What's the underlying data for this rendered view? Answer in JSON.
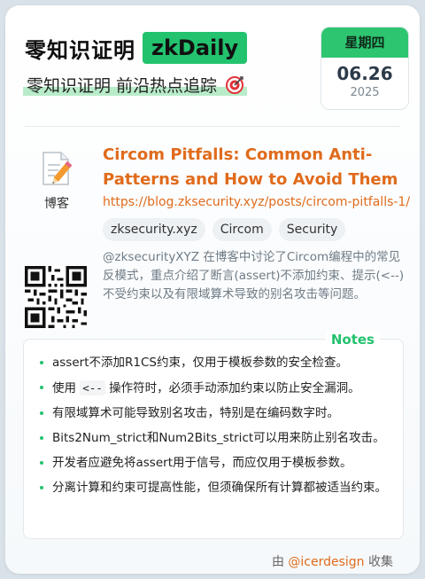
{
  "header": {
    "title": "零知识证明",
    "brand": "zkDaily",
    "subtitle": "零知识证明 前沿热点追踪",
    "subtitle_icon": "target-icon"
  },
  "date": {
    "weekday": "星期四",
    "day": "06.26",
    "year": "2025"
  },
  "post": {
    "category": "博客",
    "category_icon": "memo-icon",
    "title": "Circom Pitfalls: Common Anti-Patterns and How to Avoid Them",
    "url": "https://blog.zksecurity.xyz/posts/circom-pitfalls-1/",
    "tags": [
      "zksecurity.xyz",
      "Circom",
      "Security"
    ],
    "description": "@zksecurityXYZ 在博客中讨论了Circom编程中的常见反模式，重点介绍了断言(assert)不添加约束、提示(<--)不受约束以及有限域算术导致的别名攻击等问题。"
  },
  "notes": {
    "label": "Notes",
    "items": [
      {
        "text": "assert不添加R1CS约束，仅用于模板参数的安全检查。"
      },
      {
        "pre": "使用 ",
        "code": "<--",
        "post": " 操作符时，必须手动添加约束以防止安全漏洞。"
      },
      {
        "text": "有限域算术可能导致别名攻击，特别是在编码数字时。"
      },
      {
        "text": "Bits2Num_strict和Num2Bits_strict可以用来防止别名攻击。"
      },
      {
        "text": "开发者应避免将assert用于信号，而应仅用于模板参数。"
      },
      {
        "text": "分离计算和约束可提高性能，但须确保所有计算都被适当约束。"
      }
    ]
  },
  "footer": {
    "prefix": "由 ",
    "handle": "@icerdesign",
    "suffix": " 收集"
  },
  "colors": {
    "accent_green": "#22c26e",
    "accent_orange": "#e06b1c"
  }
}
